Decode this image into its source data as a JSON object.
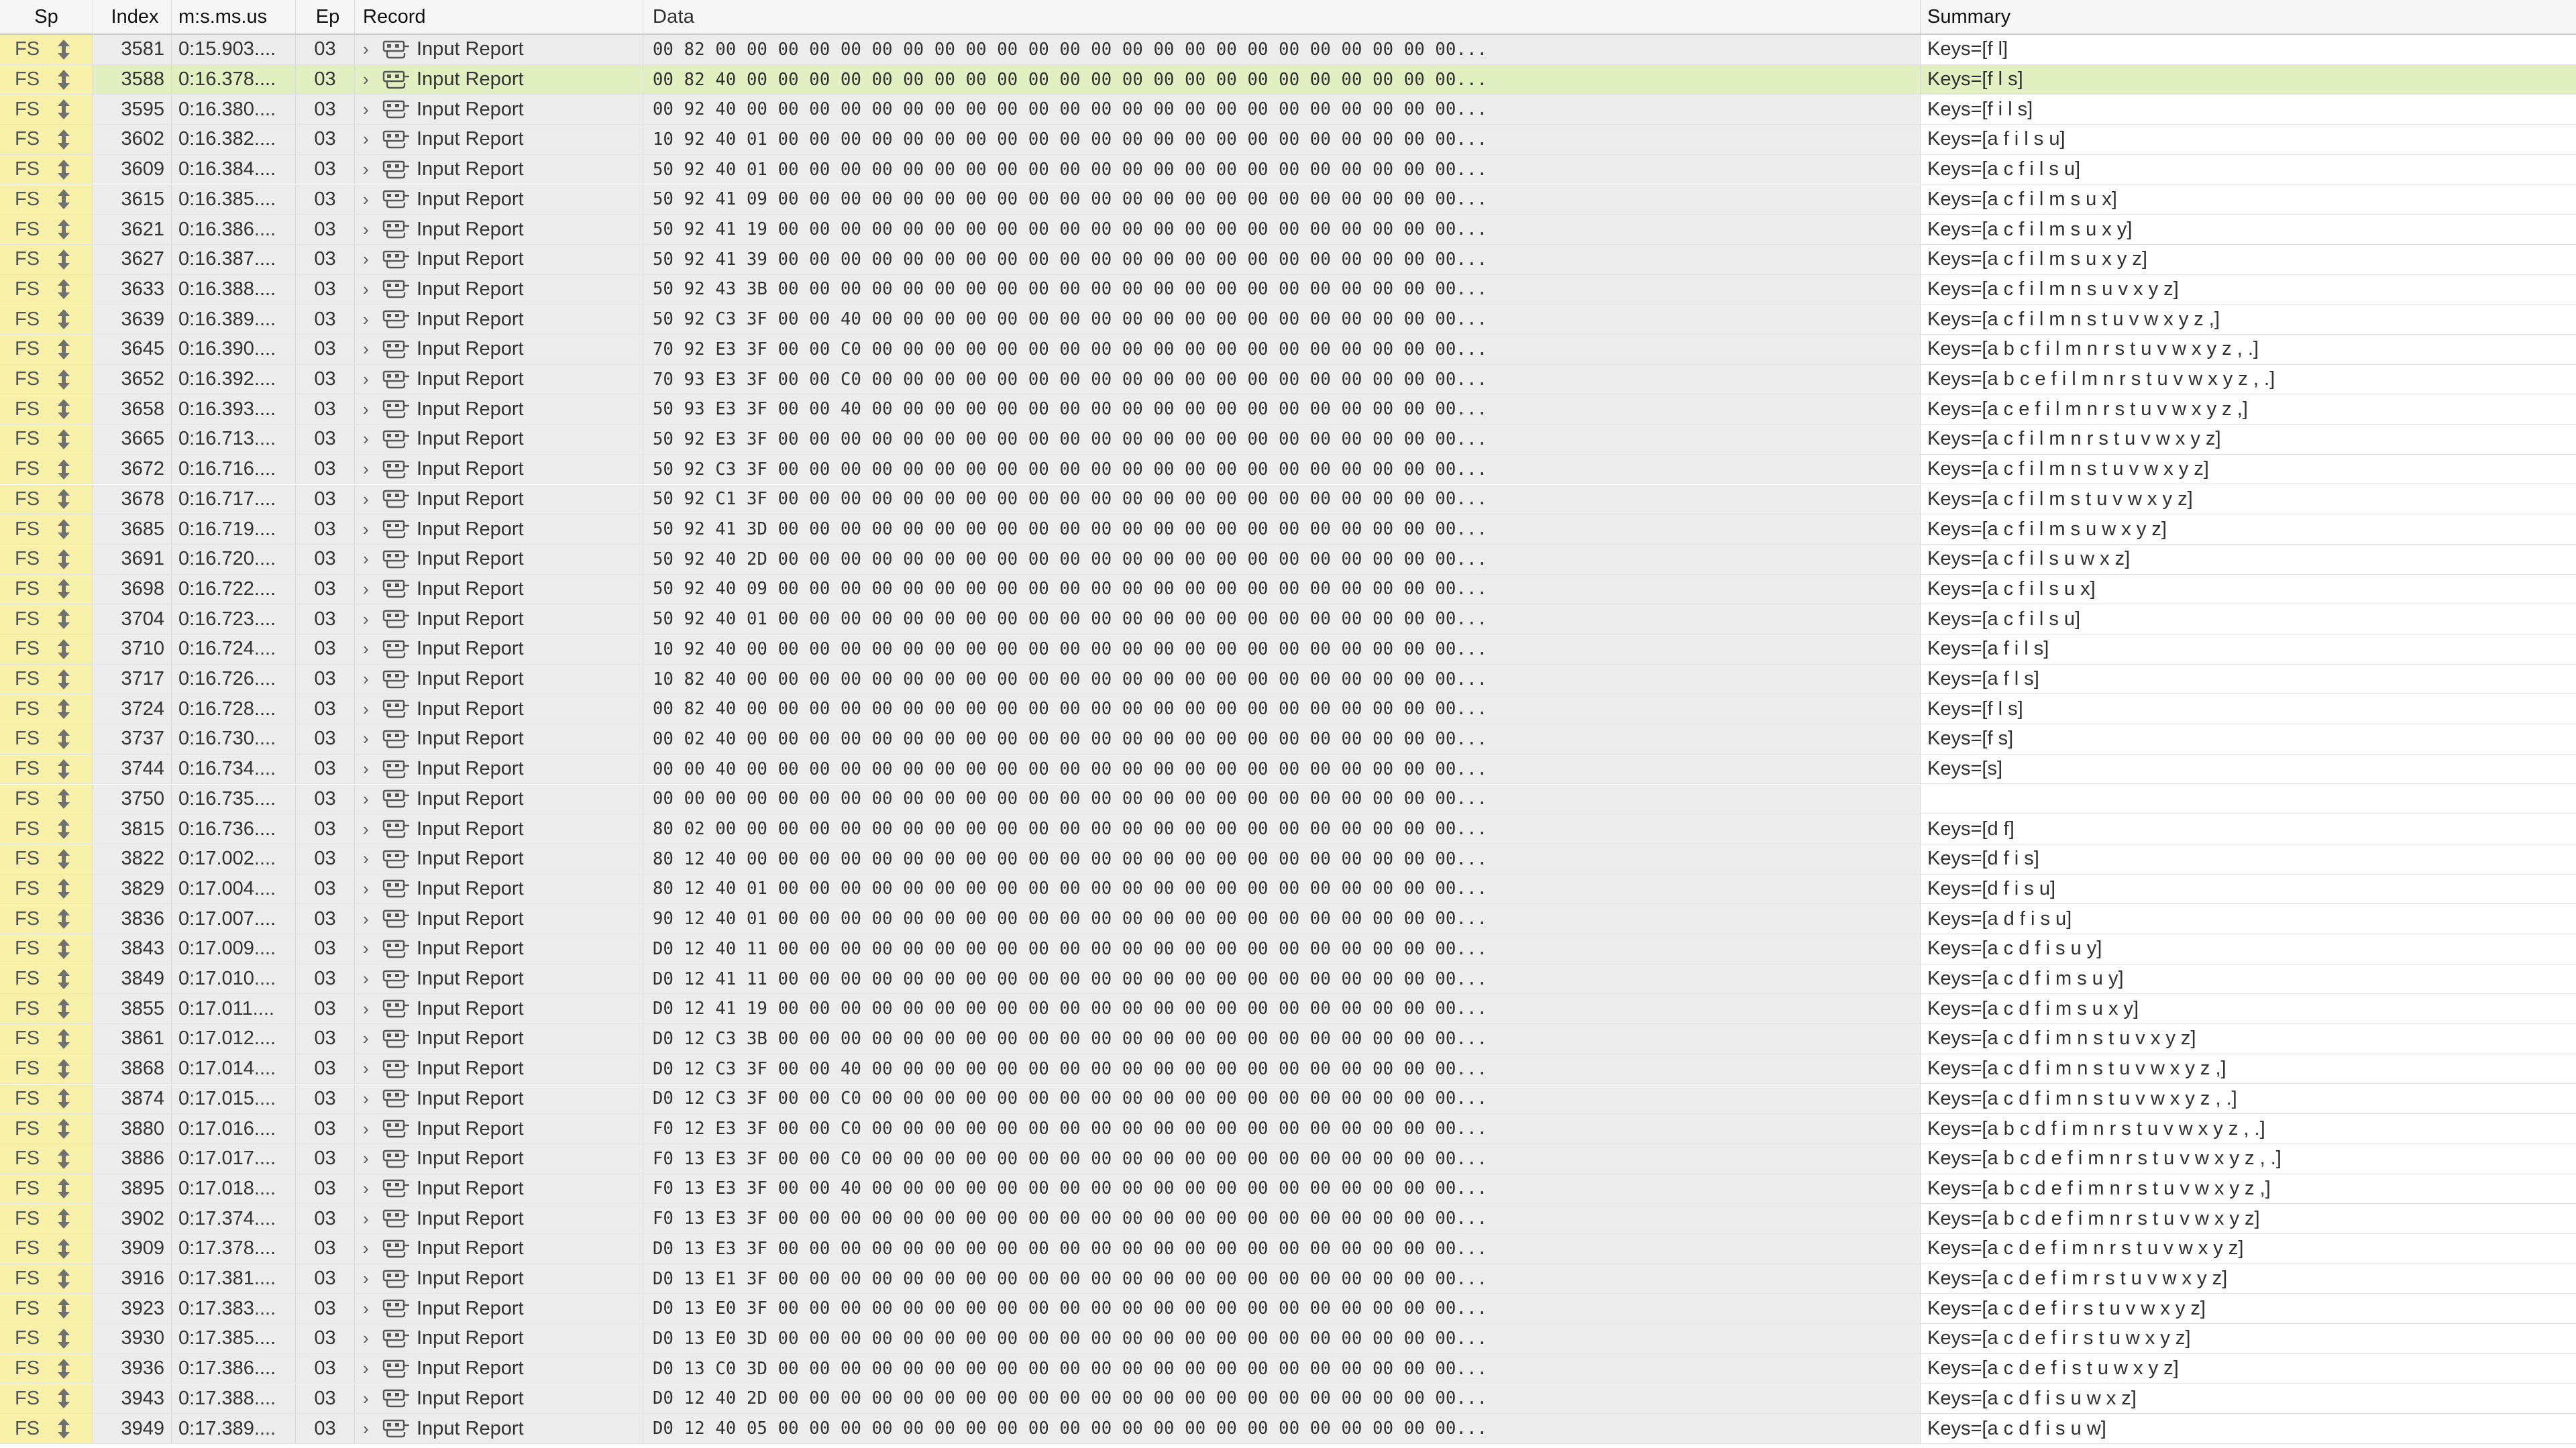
{
  "columns": {
    "sp": "Sp",
    "index": "Index",
    "time": "m:s.ms.us",
    "ep": "Ep",
    "record": "Record",
    "data": "Data",
    "summary": "Summary"
  },
  "selected_index": "3588",
  "icons": {
    "direction": "up-down-arrow-icon",
    "record": "usb-connector-icon",
    "expander": "chevron-right-icon"
  },
  "colors": {
    "speed_column_bg": "#f7f0a8",
    "selected_row_bg": "#e2efc0",
    "cell_bg": "#ececec"
  },
  "rows": [
    {
      "sp": "FS",
      "index": "3581",
      "time": "0:15.903....",
      "ep": "03",
      "record": "Input Report",
      "data": "00 82 00 00 00 00 00 00 00 00 00 00 00 00 00 00 00 00 00 00 00 00 00 00 00 00...",
      "summary": "Keys=[f l]"
    },
    {
      "sp": "FS",
      "index": "3588",
      "time": "0:16.378....",
      "ep": "03",
      "record": "Input Report",
      "data": "00 82 40 00 00 00 00 00 00 00 00 00 00 00 00 00 00 00 00 00 00 00 00 00 00 00...",
      "summary": "Keys=[f l s]"
    },
    {
      "sp": "FS",
      "index": "3595",
      "time": "0:16.380....",
      "ep": "03",
      "record": "Input Report",
      "data": "00 92 40 00 00 00 00 00 00 00 00 00 00 00 00 00 00 00 00 00 00 00 00 00 00 00...",
      "summary": "Keys=[f i l s]"
    },
    {
      "sp": "FS",
      "index": "3602",
      "time": "0:16.382....",
      "ep": "03",
      "record": "Input Report",
      "data": "10 92 40 01 00 00 00 00 00 00 00 00 00 00 00 00 00 00 00 00 00 00 00 00 00 00...",
      "summary": "Keys=[a f i l s u]"
    },
    {
      "sp": "FS",
      "index": "3609",
      "time": "0:16.384....",
      "ep": "03",
      "record": "Input Report",
      "data": "50 92 40 01 00 00 00 00 00 00 00 00 00 00 00 00 00 00 00 00 00 00 00 00 00 00...",
      "summary": "Keys=[a c f i l s u]"
    },
    {
      "sp": "FS",
      "index": "3615",
      "time": "0:16.385....",
      "ep": "03",
      "record": "Input Report",
      "data": "50 92 41 09 00 00 00 00 00 00 00 00 00 00 00 00 00 00 00 00 00 00 00 00 00 00...",
      "summary": "Keys=[a c f i l m s u x]"
    },
    {
      "sp": "FS",
      "index": "3621",
      "time": "0:16.386....",
      "ep": "03",
      "record": "Input Report",
      "data": "50 92 41 19 00 00 00 00 00 00 00 00 00 00 00 00 00 00 00 00 00 00 00 00 00 00...",
      "summary": "Keys=[a c f i l m s u x y]"
    },
    {
      "sp": "FS",
      "index": "3627",
      "time": "0:16.387....",
      "ep": "03",
      "record": "Input Report",
      "data": "50 92 41 39 00 00 00 00 00 00 00 00 00 00 00 00 00 00 00 00 00 00 00 00 00 00...",
      "summary": "Keys=[a c f i l m s u x y z]"
    },
    {
      "sp": "FS",
      "index": "3633",
      "time": "0:16.388....",
      "ep": "03",
      "record": "Input Report",
      "data": "50 92 43 3B 00 00 00 00 00 00 00 00 00 00 00 00 00 00 00 00 00 00 00 00 00 00...",
      "summary": "Keys=[a c f i l m n s u v x y z]"
    },
    {
      "sp": "FS",
      "index": "3639",
      "time": "0:16.389....",
      "ep": "03",
      "record": "Input Report",
      "data": "50 92 C3 3F 00 00 40 00 00 00 00 00 00 00 00 00 00 00 00 00 00 00 00 00 00 00...",
      "summary": "Keys=[a c f i l m n s t u v w x y z ,]"
    },
    {
      "sp": "FS",
      "index": "3645",
      "time": "0:16.390....",
      "ep": "03",
      "record": "Input Report",
      "data": "70 92 E3 3F 00 00 C0 00 00 00 00 00 00 00 00 00 00 00 00 00 00 00 00 00 00 00...",
      "summary": "Keys=[a b c f i l m n r s t u v w x y z , .]"
    },
    {
      "sp": "FS",
      "index": "3652",
      "time": "0:16.392....",
      "ep": "03",
      "record": "Input Report",
      "data": "70 93 E3 3F 00 00 C0 00 00 00 00 00 00 00 00 00 00 00 00 00 00 00 00 00 00 00...",
      "summary": "Keys=[a b c e f i l m n r s t u v w x y z , .]"
    },
    {
      "sp": "FS",
      "index": "3658",
      "time": "0:16.393....",
      "ep": "03",
      "record": "Input Report",
      "data": "50 93 E3 3F 00 00 40 00 00 00 00 00 00 00 00 00 00 00 00 00 00 00 00 00 00 00...",
      "summary": "Keys=[a c e f i l m n r s t u v w x y z ,]"
    },
    {
      "sp": "FS",
      "index": "3665",
      "time": "0:16.713....",
      "ep": "03",
      "record": "Input Report",
      "data": "50 92 E3 3F 00 00 00 00 00 00 00 00 00 00 00 00 00 00 00 00 00 00 00 00 00 00...",
      "summary": "Keys=[a c f i l m n r s t u v w x y z]"
    },
    {
      "sp": "FS",
      "index": "3672",
      "time": "0:16.716....",
      "ep": "03",
      "record": "Input Report",
      "data": "50 92 C3 3F 00 00 00 00 00 00 00 00 00 00 00 00 00 00 00 00 00 00 00 00 00 00...",
      "summary": "Keys=[a c f i l m n s t u v w x y z]"
    },
    {
      "sp": "FS",
      "index": "3678",
      "time": "0:16.717....",
      "ep": "03",
      "record": "Input Report",
      "data": "50 92 C1 3F 00 00 00 00 00 00 00 00 00 00 00 00 00 00 00 00 00 00 00 00 00 00...",
      "summary": "Keys=[a c f i l m s t u v w x y z]"
    },
    {
      "sp": "FS",
      "index": "3685",
      "time": "0:16.719....",
      "ep": "03",
      "record": "Input Report",
      "data": "50 92 41 3D 00 00 00 00 00 00 00 00 00 00 00 00 00 00 00 00 00 00 00 00 00 00...",
      "summary": "Keys=[a c f i l m s u w x y z]"
    },
    {
      "sp": "FS",
      "index": "3691",
      "time": "0:16.720....",
      "ep": "03",
      "record": "Input Report",
      "data": "50 92 40 2D 00 00 00 00 00 00 00 00 00 00 00 00 00 00 00 00 00 00 00 00 00 00...",
      "summary": "Keys=[a c f i l s u w x z]"
    },
    {
      "sp": "FS",
      "index": "3698",
      "time": "0:16.722....",
      "ep": "03",
      "record": "Input Report",
      "data": "50 92 40 09 00 00 00 00 00 00 00 00 00 00 00 00 00 00 00 00 00 00 00 00 00 00...",
      "summary": "Keys=[a c f i l s u x]"
    },
    {
      "sp": "FS",
      "index": "3704",
      "time": "0:16.723....",
      "ep": "03",
      "record": "Input Report",
      "data": "50 92 40 01 00 00 00 00 00 00 00 00 00 00 00 00 00 00 00 00 00 00 00 00 00 00...",
      "summary": "Keys=[a c f i l s u]"
    },
    {
      "sp": "FS",
      "index": "3710",
      "time": "0:16.724....",
      "ep": "03",
      "record": "Input Report",
      "data": "10 92 40 00 00 00 00 00 00 00 00 00 00 00 00 00 00 00 00 00 00 00 00 00 00 00...",
      "summary": "Keys=[a f i l s]"
    },
    {
      "sp": "FS",
      "index": "3717",
      "time": "0:16.726....",
      "ep": "03",
      "record": "Input Report",
      "data": "10 82 40 00 00 00 00 00 00 00 00 00 00 00 00 00 00 00 00 00 00 00 00 00 00 00...",
      "summary": "Keys=[a f l s]"
    },
    {
      "sp": "FS",
      "index": "3724",
      "time": "0:16.728....",
      "ep": "03",
      "record": "Input Report",
      "data": "00 82 40 00 00 00 00 00 00 00 00 00 00 00 00 00 00 00 00 00 00 00 00 00 00 00...",
      "summary": "Keys=[f l s]"
    },
    {
      "sp": "FS",
      "index": "3737",
      "time": "0:16.730....",
      "ep": "03",
      "record": "Input Report",
      "data": "00 02 40 00 00 00 00 00 00 00 00 00 00 00 00 00 00 00 00 00 00 00 00 00 00 00...",
      "summary": "Keys=[f s]"
    },
    {
      "sp": "FS",
      "index": "3744",
      "time": "0:16.734....",
      "ep": "03",
      "record": "Input Report",
      "data": "00 00 40 00 00 00 00 00 00 00 00 00 00 00 00 00 00 00 00 00 00 00 00 00 00 00...",
      "summary": "Keys=[s]"
    },
    {
      "sp": "FS",
      "index": "3750",
      "time": "0:16.735....",
      "ep": "03",
      "record": "Input Report",
      "data": "00 00 00 00 00 00 00 00 00 00 00 00 00 00 00 00 00 00 00 00 00 00 00 00 00 00...",
      "summary": ""
    },
    {
      "sp": "FS",
      "index": "3815",
      "time": "0:16.736....",
      "ep": "03",
      "record": "Input Report",
      "data": "80 02 00 00 00 00 00 00 00 00 00 00 00 00 00 00 00 00 00 00 00 00 00 00 00 00...",
      "summary": "Keys=[d f]"
    },
    {
      "sp": "FS",
      "index": "3822",
      "time": "0:17.002....",
      "ep": "03",
      "record": "Input Report",
      "data": "80 12 40 00 00 00 00 00 00 00 00 00 00 00 00 00 00 00 00 00 00 00 00 00 00 00...",
      "summary": "Keys=[d f i s]"
    },
    {
      "sp": "FS",
      "index": "3829",
      "time": "0:17.004....",
      "ep": "03",
      "record": "Input Report",
      "data": "80 12 40 01 00 00 00 00 00 00 00 00 00 00 00 00 00 00 00 00 00 00 00 00 00 00...",
      "summary": "Keys=[d f i s u]"
    },
    {
      "sp": "FS",
      "index": "3836",
      "time": "0:17.007....",
      "ep": "03",
      "record": "Input Report",
      "data": "90 12 40 01 00 00 00 00 00 00 00 00 00 00 00 00 00 00 00 00 00 00 00 00 00 00...",
      "summary": "Keys=[a d f i s u]"
    },
    {
      "sp": "FS",
      "index": "3843",
      "time": "0:17.009....",
      "ep": "03",
      "record": "Input Report",
      "data": "D0 12 40 11 00 00 00 00 00 00 00 00 00 00 00 00 00 00 00 00 00 00 00 00 00 00...",
      "summary": "Keys=[a c d f i s u y]"
    },
    {
      "sp": "FS",
      "index": "3849",
      "time": "0:17.010....",
      "ep": "03",
      "record": "Input Report",
      "data": "D0 12 41 11 00 00 00 00 00 00 00 00 00 00 00 00 00 00 00 00 00 00 00 00 00 00...",
      "summary": "Keys=[a c d f i m s u y]"
    },
    {
      "sp": "FS",
      "index": "3855",
      "time": "0:17.011....",
      "ep": "03",
      "record": "Input Report",
      "data": "D0 12 41 19 00 00 00 00 00 00 00 00 00 00 00 00 00 00 00 00 00 00 00 00 00 00...",
      "summary": "Keys=[a c d f i m s u x y]"
    },
    {
      "sp": "FS",
      "index": "3861",
      "time": "0:17.012....",
      "ep": "03",
      "record": "Input Report",
      "data": "D0 12 C3 3B 00 00 00 00 00 00 00 00 00 00 00 00 00 00 00 00 00 00 00 00 00 00...",
      "summary": "Keys=[a c d f i m n s t u v x y z]"
    },
    {
      "sp": "FS",
      "index": "3868",
      "time": "0:17.014....",
      "ep": "03",
      "record": "Input Report",
      "data": "D0 12 C3 3F 00 00 40 00 00 00 00 00 00 00 00 00 00 00 00 00 00 00 00 00 00 00...",
      "summary": "Keys=[a c d f i m n s t u v w x y z ,]"
    },
    {
      "sp": "FS",
      "index": "3874",
      "time": "0:17.015....",
      "ep": "03",
      "record": "Input Report",
      "data": "D0 12 C3 3F 00 00 C0 00 00 00 00 00 00 00 00 00 00 00 00 00 00 00 00 00 00 00...",
      "summary": "Keys=[a c d f i m n s t u v w x y z , .]"
    },
    {
      "sp": "FS",
      "index": "3880",
      "time": "0:17.016....",
      "ep": "03",
      "record": "Input Report",
      "data": "F0 12 E3 3F 00 00 C0 00 00 00 00 00 00 00 00 00 00 00 00 00 00 00 00 00 00 00...",
      "summary": "Keys=[a b c d f i m n r s t u v w x y z , .]"
    },
    {
      "sp": "FS",
      "index": "3886",
      "time": "0:17.017....",
      "ep": "03",
      "record": "Input Report",
      "data": "F0 13 E3 3F 00 00 C0 00 00 00 00 00 00 00 00 00 00 00 00 00 00 00 00 00 00 00...",
      "summary": "Keys=[a b c d e f i m n r s t u v w x y z , .]"
    },
    {
      "sp": "FS",
      "index": "3895",
      "time": "0:17.018....",
      "ep": "03",
      "record": "Input Report",
      "data": "F0 13 E3 3F 00 00 40 00 00 00 00 00 00 00 00 00 00 00 00 00 00 00 00 00 00 00...",
      "summary": "Keys=[a b c d e f i m n r s t u v w x y z ,]"
    },
    {
      "sp": "FS",
      "index": "3902",
      "time": "0:17.374....",
      "ep": "03",
      "record": "Input Report",
      "data": "F0 13 E3 3F 00 00 00 00 00 00 00 00 00 00 00 00 00 00 00 00 00 00 00 00 00 00...",
      "summary": "Keys=[a b c d e f i m n r s t u v w x y z]"
    },
    {
      "sp": "FS",
      "index": "3909",
      "time": "0:17.378....",
      "ep": "03",
      "record": "Input Report",
      "data": "D0 13 E3 3F 00 00 00 00 00 00 00 00 00 00 00 00 00 00 00 00 00 00 00 00 00 00...",
      "summary": "Keys=[a c d e f i m n r s t u v w x y z]"
    },
    {
      "sp": "FS",
      "index": "3916",
      "time": "0:17.381....",
      "ep": "03",
      "record": "Input Report",
      "data": "D0 13 E1 3F 00 00 00 00 00 00 00 00 00 00 00 00 00 00 00 00 00 00 00 00 00 00...",
      "summary": "Keys=[a c d e f i m r s t u v w x y z]"
    },
    {
      "sp": "FS",
      "index": "3923",
      "time": "0:17.383....",
      "ep": "03",
      "record": "Input Report",
      "data": "D0 13 E0 3F 00 00 00 00 00 00 00 00 00 00 00 00 00 00 00 00 00 00 00 00 00 00...",
      "summary": "Keys=[a c d e f i r s t u v w x y z]"
    },
    {
      "sp": "FS",
      "index": "3930",
      "time": "0:17.385....",
      "ep": "03",
      "record": "Input Report",
      "data": "D0 13 E0 3D 00 00 00 00 00 00 00 00 00 00 00 00 00 00 00 00 00 00 00 00 00 00...",
      "summary": "Keys=[a c d e f i r s t u w x y z]"
    },
    {
      "sp": "FS",
      "index": "3936",
      "time": "0:17.386....",
      "ep": "03",
      "record": "Input Report",
      "data": "D0 13 C0 3D 00 00 00 00 00 00 00 00 00 00 00 00 00 00 00 00 00 00 00 00 00 00...",
      "summary": "Keys=[a c d e f i s t u w x y z]"
    },
    {
      "sp": "FS",
      "index": "3943",
      "time": "0:17.388....",
      "ep": "03",
      "record": "Input Report",
      "data": "D0 12 40 2D 00 00 00 00 00 00 00 00 00 00 00 00 00 00 00 00 00 00 00 00 00 00...",
      "summary": "Keys=[a c d f i s u w x z]"
    },
    {
      "sp": "FS",
      "index": "3949",
      "time": "0:17.389....",
      "ep": "03",
      "record": "Input Report",
      "data": "D0 12 40 05 00 00 00 00 00 00 00 00 00 00 00 00 00 00 00 00 00 00 00 00 00 00...",
      "summary": "Keys=[a c d f i s u w]"
    }
  ]
}
